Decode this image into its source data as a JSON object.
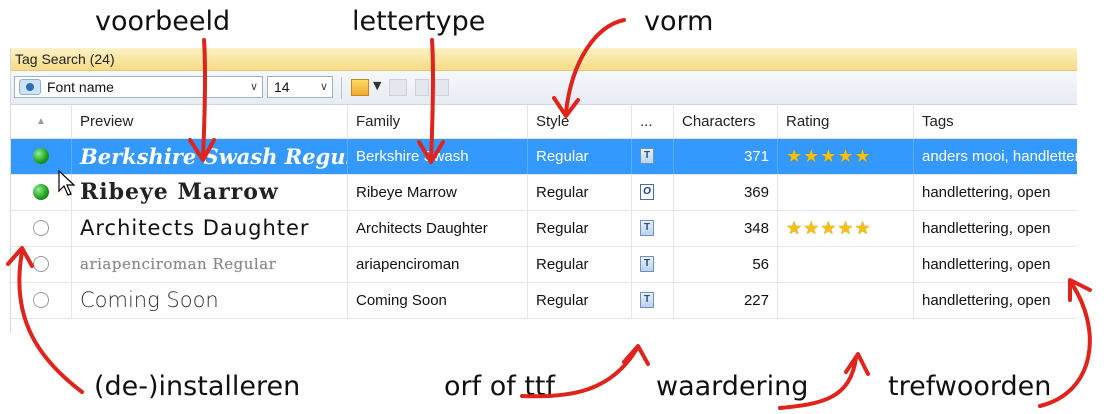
{
  "annotations": {
    "voorbeeld": "voorbeeld",
    "lettertype": "lettertype",
    "vorm": "vorm",
    "installeren": "(de-)installeren",
    "orf": "orf of ttf",
    "waardering": "waardering",
    "trefwoorden": "trefwoorden"
  },
  "panel": {
    "title": "Tag Search (24)"
  },
  "toolbar": {
    "font_field": "Font name",
    "size_field": "14"
  },
  "columns": {
    "sort": "▲",
    "preview": "Preview",
    "family": "Family",
    "style": "Style",
    "format": "...",
    "characters": "Characters",
    "rating": "Rating",
    "tags": "Tags"
  },
  "rows": [
    {
      "installed": true,
      "preview": "Berkshire Swash Regular",
      "family": "Berkshire Swash",
      "style": "Regular",
      "format": "ttf",
      "characters": "371",
      "rating": 5,
      "tags": "anders mooi, handlettering",
      "selected": true
    },
    {
      "installed": true,
      "preview": "Ribeye Marrow",
      "family": "Ribeye Marrow",
      "style": "Regular",
      "format": "otf",
      "characters": "369",
      "rating": 0,
      "tags": "handlettering, open"
    },
    {
      "installed": false,
      "preview": "Architects Daughter",
      "family": "Architects Daughter",
      "style": "Regular",
      "format": "ttf",
      "characters": "348",
      "rating": 5,
      "tags": "handlettering, open"
    },
    {
      "installed": false,
      "preview": "ariapenciroman Regular",
      "family": "ariapenciroman",
      "style": "Regular",
      "format": "ttf",
      "characters": "56",
      "rating": 0,
      "tags": "handlettering, open"
    },
    {
      "installed": false,
      "preview": "Coming Soon",
      "family": "Coming Soon",
      "style": "Regular",
      "format": "ttf",
      "characters": "227",
      "rating": 0,
      "tags": "handlettering, open"
    }
  ],
  "colors": {
    "selection": "#3399ff",
    "arrow": "#e0241b",
    "star": "#f4c10f",
    "installed": "#1c9a1c"
  }
}
